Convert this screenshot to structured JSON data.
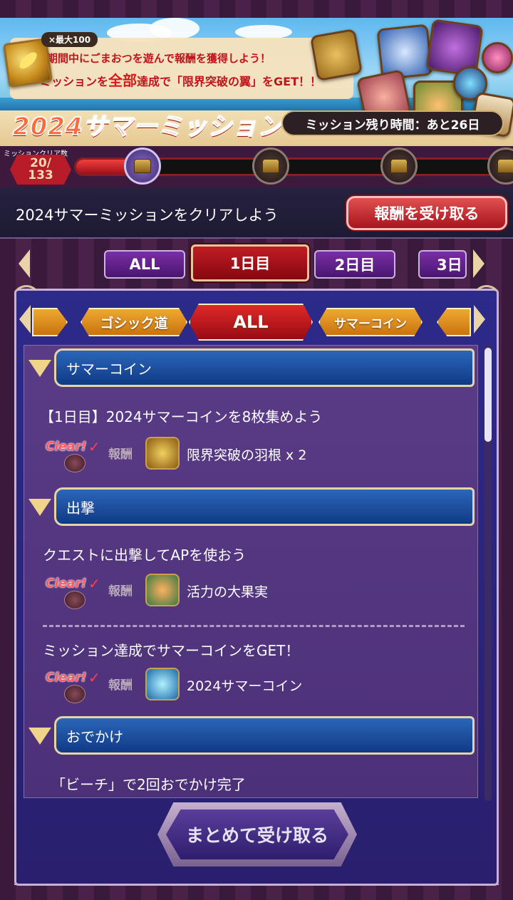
{
  "banner": {
    "max_badge": "×最大100",
    "line1": "期間中にごまおつを遊んで報酬を獲得しよう！",
    "line2_pre": "ミッションを",
    "line2_hl": "全部",
    "line2_post": "達成で「限界突破の翼」をGET！！",
    "title": "2024サマーミッション",
    "time_left": "ミッション残り時間：あと26日"
  },
  "progress": {
    "label": "ミッションクリア数",
    "cleared": "20/",
    "total": "133",
    "fraction": 0.15
  },
  "header": {
    "prompt": "2024サマーミッションをクリアしよう",
    "receive_label": "報酬を受け取る"
  },
  "day_tabs": [
    "ALL",
    "1日目",
    "2日目",
    "3日"
  ],
  "active_day": "1日目",
  "category_tabs": {
    "left_partial": "ゴシック道",
    "active": "ALL",
    "right": "サマーコイン"
  },
  "sections": [
    {
      "title": "サマーコイン",
      "missions": [
        {
          "title": "【1日目】2024サマーコインを8枚集めよう",
          "clear": "Clear!",
          "reward_label": "報酬",
          "reward": "限界突破の羽根 x 2"
        }
      ]
    },
    {
      "title": "出撃",
      "missions": [
        {
          "title": "クエストに出撃してAPを使おう",
          "clear": "Clear!",
          "reward_label": "報酬",
          "reward": "活力の大果実"
        },
        {
          "title": "ミッション達成でサマーコインをGET！",
          "clear": "Clear!",
          "reward_label": "報酬",
          "reward": "2024サマーコイン"
        }
      ]
    },
    {
      "title": "おでかけ",
      "missions": [
        {
          "title": "「ビーチ」で2回おでかけ完了"
        }
      ]
    }
  ],
  "bulk_receive_label": "まとめて受け取る",
  "colors": {
    "accent_red": "#c21c24",
    "tab_purple": "#7a2ea6",
    "section_blue": "#1f4fa0",
    "gold": "#e8d4a6"
  }
}
